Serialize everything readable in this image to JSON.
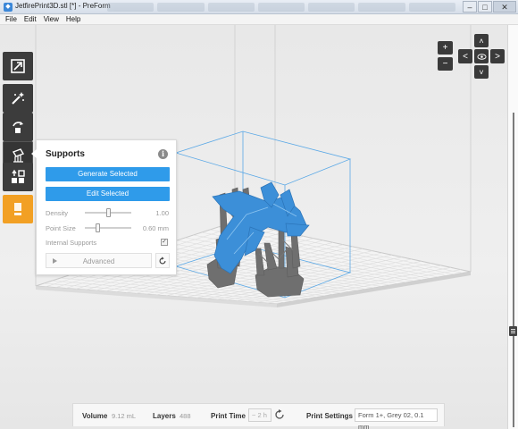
{
  "window": {
    "title": "JetfirePrint3D.stl [*] - PreForm",
    "minimize": "–",
    "maximize": "□",
    "close": "✕"
  },
  "menu": [
    "File",
    "Edit",
    "View",
    "Help"
  ],
  "toolbar": {
    "items": [
      "zoom-fit-icon",
      "magic-wand-icon",
      "orientation-icon",
      "supports-icon",
      "layout-icon",
      "print-icon"
    ],
    "accent_color": "#f2a024"
  },
  "supports_panel": {
    "title": "Supports",
    "generate_label": "Generate Selected",
    "edit_label": "Edit Selected",
    "density_label": "Density",
    "density_value": "1.00",
    "density_level": 0.5,
    "point_size_label": "Point Size",
    "point_size_value": "0.60 mm",
    "point_size_level": 0.25,
    "internal_supports_label": "Internal Supports",
    "internal_supports_checked": true,
    "advanced_label": "Advanced",
    "button_color": "#2f9bea"
  },
  "view_controls": {
    "zoom_in": "+",
    "zoom_out": "−",
    "up": "˄",
    "down": "˅",
    "left": "<",
    "right": ">"
  },
  "status": {
    "volume_label": "Volume",
    "volume_value": "9.12 mL",
    "layers_label": "Layers",
    "layers_value": "488",
    "print_time_label": "Print Time",
    "print_time_value": "~ 2 h",
    "print_settings_label": "Print Settings",
    "print_settings_value": "Form 1+, Grey 02, 0.1 mm"
  },
  "model_color": "#3c8fd8",
  "support_color": "#6f6f6f"
}
